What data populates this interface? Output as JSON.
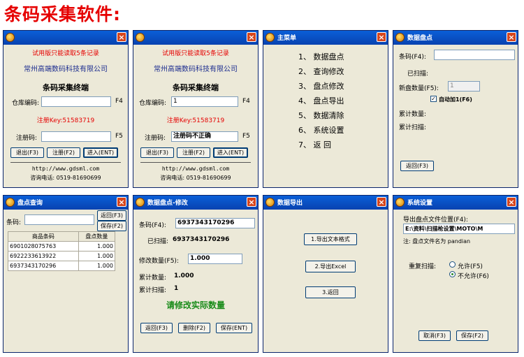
{
  "page": {
    "title": "条码采集软件:"
  },
  "w1": {
    "trial": "试用版只能读取5条记录",
    "company": "常州高端数码科技有限公司",
    "heading": "条码采集终端",
    "warehouse_label": "仓库编码:",
    "warehouse_value": "",
    "warehouse_key": "F4",
    "key_text": "注册Key:51583719",
    "reg_label": "注册码:",
    "reg_value": "",
    "reg_key": "F5",
    "btn_exit": "退出(F3)",
    "btn_reg": "注册(F2)",
    "btn_enter": "进入(ENT)",
    "url": "http://www.gdsml.com",
    "phone": "咨询电话: 0519-81690699"
  },
  "w2": {
    "trial": "试用版只能读取5条记录",
    "company": "常州高端数码科技有限公司",
    "heading": "条码采集终端",
    "warehouse_label": "仓库编码:",
    "warehouse_value": "1",
    "warehouse_key": "F4",
    "key_text": "注册Key:51583719",
    "reg_label": "注册码:",
    "reg_value": "注册码不正确",
    "reg_key": "F5",
    "btn_exit": "退出(F3)",
    "btn_reg": "注册(F2)",
    "btn_enter": "进入(ENT)",
    "url": "http://www.gdsml.com",
    "phone": "咨询电话: 0519-81690699"
  },
  "w3": {
    "title": "主菜单",
    "items": [
      "1、 数据盘点",
      "2、 查询修改",
      "3、 盘点修改",
      "4、 盘点导出",
      "5、 数据清除",
      "6、 系统设置",
      "7、 返  回"
    ]
  },
  "w4": {
    "title": "数据盘点",
    "barcode_label": "条码(F4):",
    "barcode_value": "",
    "scanned_label": "已扫描:",
    "scanned_value": "",
    "newqty_label": "新盘数量(F5):",
    "newqty_value": "1",
    "auto_label": "自动加1(F6)",
    "total_qty_label": "累计数量:",
    "total_scan_label": "累计扫描:",
    "btn_back": "返回(F3)"
  },
  "w5": {
    "title": "盘点查询",
    "barcode_label": "条码:",
    "barcode_value": "",
    "btn_back": "返回(F3)",
    "btn_save": "保存(F2)",
    "columns": [
      "商品条码",
      "盘点数量"
    ],
    "rows": [
      [
        "6901028075763",
        "1.000"
      ],
      [
        "6922233613922",
        "1.000"
      ],
      [
        "6937343170296",
        "1.000"
      ]
    ]
  },
  "w6": {
    "title": "数据盘点-修改",
    "barcode_label": "条码(F4):",
    "barcode_value": "6937343170296",
    "scanned_label": "已扫描:",
    "scanned_value": "6937343170296",
    "qty_label": "修改数量(F5):",
    "qty_value": "1.000",
    "total_qty_label": "累计数量:",
    "total_qty_value": "1.000",
    "total_scan_label": "累计扫描:",
    "total_scan_value": "1",
    "prompt": "请修改实际数量",
    "btn_back": "返回(F3)",
    "btn_delete": "删除(F2)",
    "btn_save": "保存(ENT)"
  },
  "w7": {
    "title": "数据导出",
    "btn_txt": "1.导出文本格式",
    "btn_excel": "2.导出Excel",
    "btn_back": "3.返回"
  },
  "w8": {
    "title": "系统设置",
    "path_label": "导出盘点文件位置(F4):",
    "path_value": "E:\\资料\\扫描枪设置\\MOTO\\M",
    "note": "注: 盘点文件名为 pandian",
    "repeat_label": "重复扫描:",
    "opt_allow": "允许(F5)",
    "opt_deny": "不允许(F6)",
    "btn_cancel": "取消(F3)",
    "btn_save": "保存(F2)"
  }
}
